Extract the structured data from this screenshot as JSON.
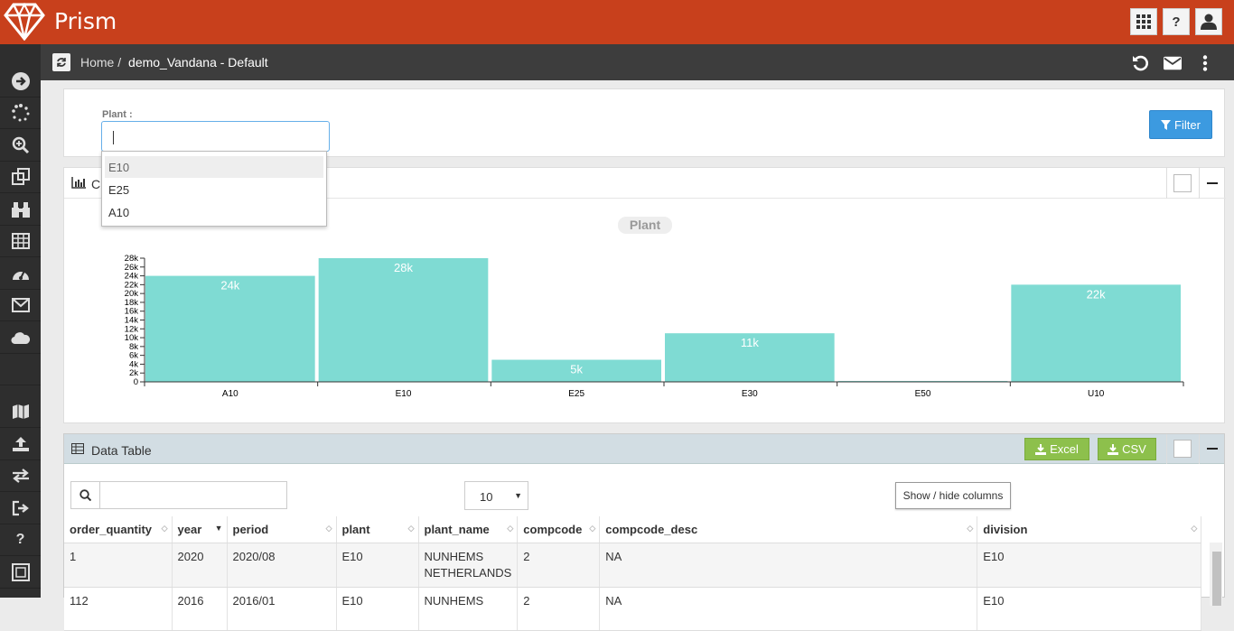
{
  "app": {
    "name": "Prism",
    "brand_color": "#c8401c"
  },
  "header": {
    "icons": [
      "grid-icon",
      "help-icon",
      "user-icon"
    ],
    "help_glyph": "?"
  },
  "breadcrumb": {
    "home": "Home",
    "separator": "/",
    "current": "demo_Vandana - Default"
  },
  "sidebar": {
    "icons": [
      "arrow-right-icon",
      "spinner-icon",
      "zoom-icon",
      "clone-icon",
      "binoculars-icon",
      "table-icon",
      "dashboard-icon",
      "mail-icon",
      "cloud-icon",
      "map-icon",
      "upload-icon",
      "exchange-icon",
      "sign-out-icon",
      "question-icon",
      "frame-icon"
    ]
  },
  "filter": {
    "label": "Plant :",
    "input_value": "",
    "button_label": "Filter",
    "options": [
      "E10",
      "E25",
      "A10"
    ],
    "highlighted": "E10"
  },
  "chart_panel": {
    "title_visible": "Cl"
  },
  "chart_data": {
    "type": "bar",
    "title": "Plant",
    "categories": [
      "A10",
      "E10",
      "E25",
      "E30",
      "E50",
      "U10"
    ],
    "values": [
      24000,
      28000,
      5000,
      11000,
      200,
      22000
    ],
    "data_labels": [
      "24k",
      "28k",
      "5k",
      "11k",
      "",
      "22k"
    ],
    "yticks": [
      "0",
      "2k",
      "4k",
      "6k",
      "8k",
      "10k",
      "12k",
      "14k",
      "16k",
      "18k",
      "20k",
      "22k",
      "24k",
      "26k",
      "28k"
    ],
    "ylim": [
      0,
      28000
    ],
    "bar_color": "#7fdbd3"
  },
  "data_table": {
    "title": "Data Table",
    "excel_label": "Excel",
    "csv_label": "CSV",
    "page_length": "10",
    "show_hide_label": "Show / hide columns",
    "columns": [
      "order_quantity",
      "year",
      "period",
      "plant",
      "plant_name",
      "compcode",
      "compcode_desc",
      "division"
    ],
    "rows": [
      [
        "1",
        "2020",
        "2020/08",
        "E10",
        "NUNHEMS NETHERLANDS",
        "2",
        "NA",
        "E10"
      ],
      [
        "112",
        "2016",
        "2016/01",
        "E10",
        "NUNHEMS",
        "2",
        "NA",
        "E10"
      ]
    ]
  }
}
